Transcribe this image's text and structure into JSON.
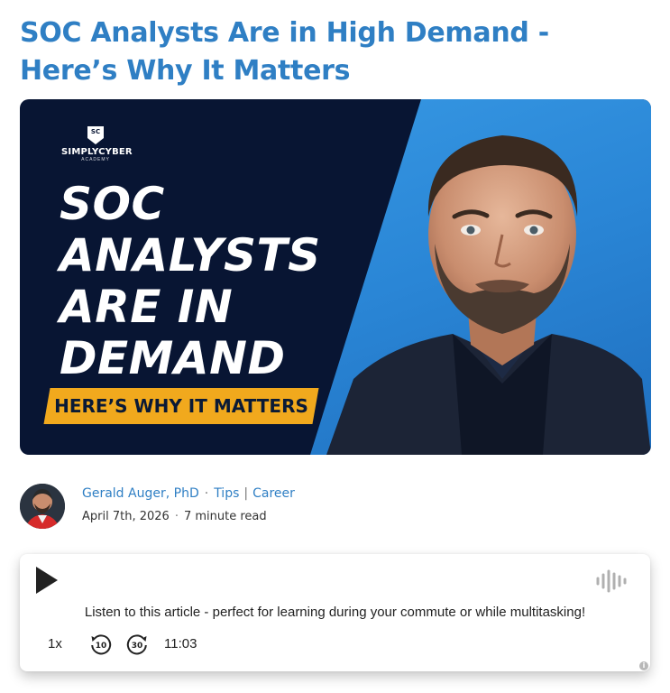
{
  "article": {
    "title": "SOC Analysts Are in High Demand - Here’s Why It Matters"
  },
  "hero": {
    "logo_text": "SIMPLYCYBER",
    "logo_subtext": "ACADEMY",
    "logo_mark": "SC",
    "headline": "SOC\nANALYSTS\nARE IN\nDEMAND",
    "banner": "HERE’S WHY IT MATTERS",
    "colors": {
      "navy": "#081533",
      "blue": "#2a86d6",
      "banner": "#f1a91d"
    }
  },
  "byline": {
    "author": "Gerald Auger, PhD",
    "separator": "·",
    "categories": [
      "Tips",
      "Career"
    ],
    "category_separator": "|",
    "date": "April 7th, 2026",
    "read_time": "7 minute read"
  },
  "player": {
    "description": "Listen to this article - perfect for learning during your commute or while multitasking!",
    "speed": "1x",
    "rewind_seconds": "10",
    "forward_seconds": "30",
    "duration": "11:03",
    "icons": [
      "play-icon",
      "waveform-icon",
      "rewind-10-icon",
      "forward-30-icon",
      "info-icon"
    ]
  },
  "theme": {
    "accent": "#2f7fc4"
  }
}
